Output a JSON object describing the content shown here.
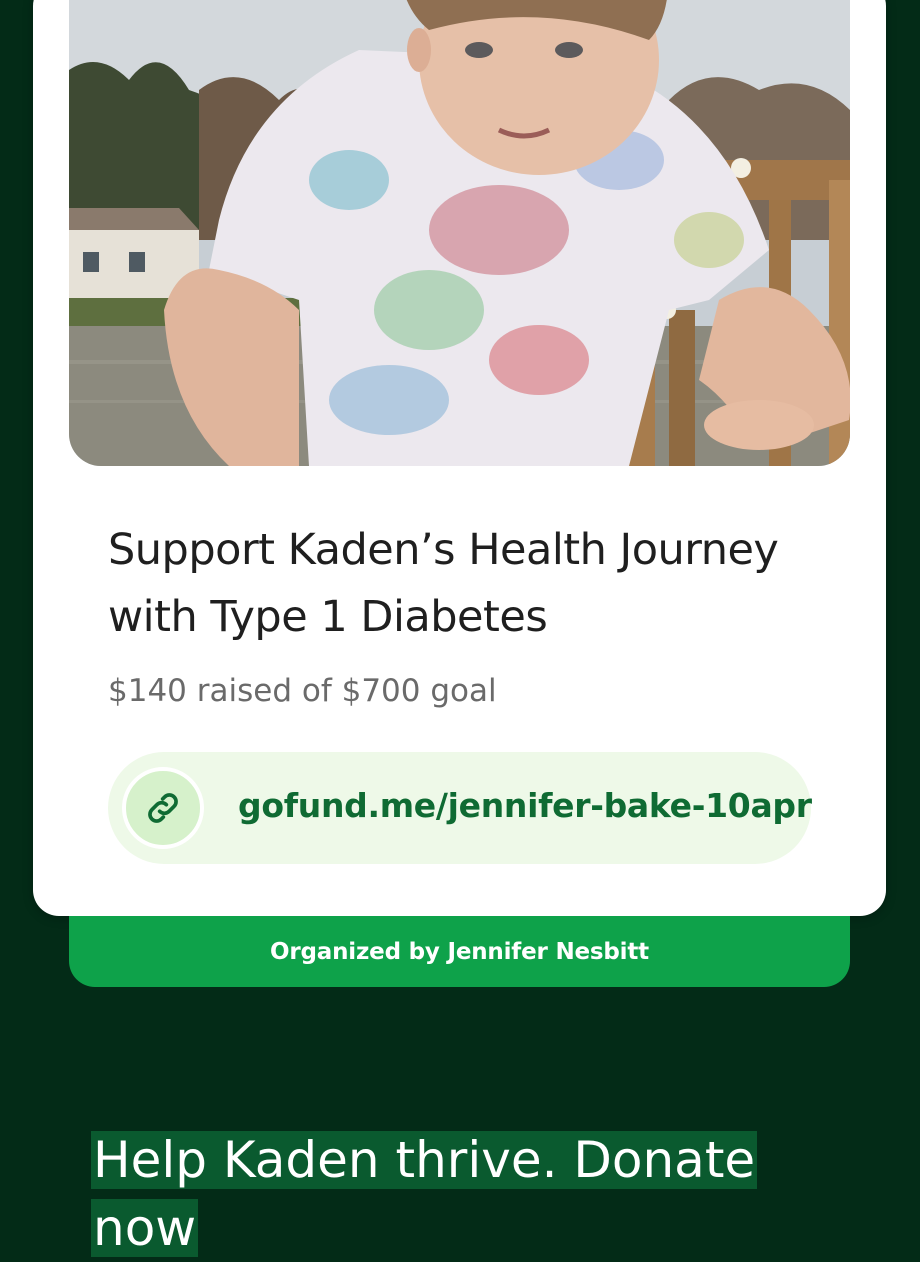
{
  "campaign": {
    "title": "Support Kaden’s Health Journey with Type 1 Diabetes",
    "raised_text": "$140 raised of $700 goal",
    "amount_raised": 140,
    "goal": 700,
    "link": "gofund.me/jennifer-bake-10apr",
    "link_icon": "link-icon",
    "organizer": "Organized by Jennifer Nesbitt"
  },
  "caption": "Help Kaden thrive. Donate now",
  "colors": {
    "background": "#032b17",
    "card": "#ffffff",
    "accent_green": "#0ea24a",
    "link_text": "#0f6b33",
    "link_pill": "#eef9e8",
    "caption_highlight": "#0a5a2f"
  }
}
